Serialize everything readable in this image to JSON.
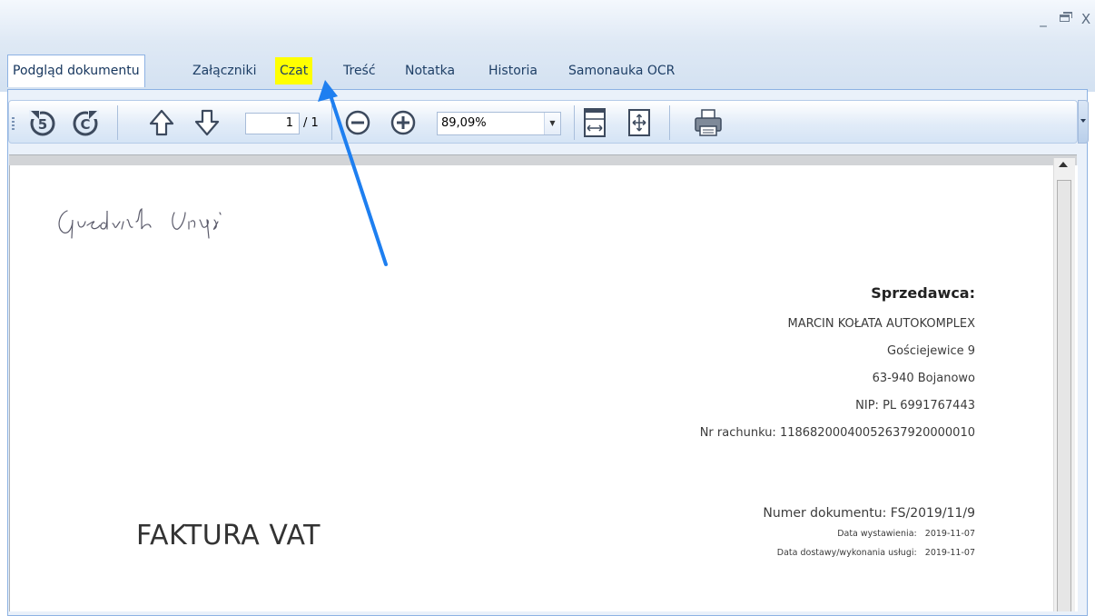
{
  "window": {
    "minimize_glyph": "_",
    "close_glyph": "X"
  },
  "tabs": [
    {
      "label": "Podgląd dokumentu",
      "active": true
    },
    {
      "label": "Załączniki"
    },
    {
      "label": "Czat",
      "highlighted": true,
      "highlight_color": "#ffff00"
    },
    {
      "label": "Treść"
    },
    {
      "label": "Notatka"
    },
    {
      "label": "Historia"
    },
    {
      "label": "Samonauka OCR"
    }
  ],
  "toolbar": {
    "icons": [
      "rotate-left-icon",
      "rotate-right-icon",
      "arrow-up-icon",
      "arrow-down-icon",
      "zoom-out-icon",
      "zoom-in-icon",
      "fit-width-icon",
      "fit-page-icon",
      "print-icon"
    ],
    "current_page": "1",
    "page_total": "/ 1",
    "zoom": "89,09%"
  },
  "document": {
    "seller_heading": "Sprzedawca:",
    "seller_name": "MARCIN KOŁATA AUTOKOMPLEX",
    "seller_street": "Gościejewice 9",
    "seller_city": "63-940 Bojanowo",
    "seller_nip": "NIP: PL 6991767443",
    "seller_account": "Nr rachunku: 11868200040052637920000010",
    "invoice_title": "FAKTURA VAT",
    "document_number": "Numer dokumentu: FS/2019/11/9",
    "issue_date_label": "Data wystawienia:",
    "issue_date": "2019-11-07",
    "delivery_date_label": "Data dostawy/wykonania usługi:",
    "delivery_date": "2019-11-07"
  },
  "annotation": {
    "arrow_color": "#1e7ff0",
    "points_to": "Czat"
  }
}
